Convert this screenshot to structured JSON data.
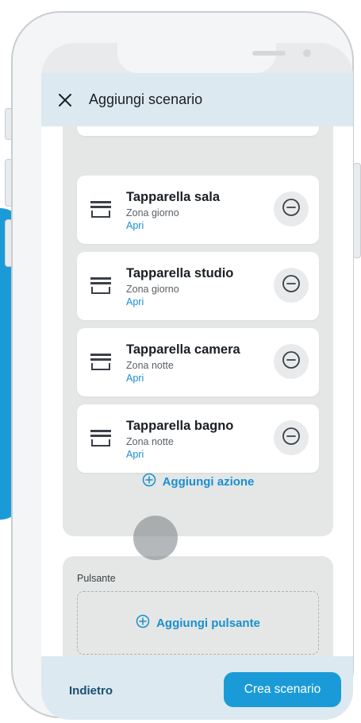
{
  "header": {
    "title": "Aggiungi scenario",
    "close_icon": "close-icon"
  },
  "actions": [
    {
      "title": "Tapparella sala",
      "zone": "Zona giorno",
      "action": "Apri",
      "icon": "shutter-icon"
    },
    {
      "title": "Tapparella studio",
      "zone": "Zona giorno",
      "action": "Apri",
      "icon": "shutter-icon"
    },
    {
      "title": "Tapparella camera",
      "zone": "Zona notte",
      "action": "Apri",
      "icon": "shutter-icon"
    },
    {
      "title": "Tapparella bagno",
      "zone": "Zona notte",
      "action": "Apri",
      "icon": "shutter-icon"
    }
  ],
  "add_action_label": "Aggiungi azione",
  "button_section": {
    "label": "Pulsante",
    "add_label": "Aggiungi pulsante"
  },
  "footer": {
    "back_label": "Indietro",
    "create_label": "Crea scenario"
  },
  "colors": {
    "accent": "#1a9bd8",
    "link": "#1a8fd0",
    "header_bg": "#dde9f0",
    "panel_bg": "#e4e7e5"
  }
}
